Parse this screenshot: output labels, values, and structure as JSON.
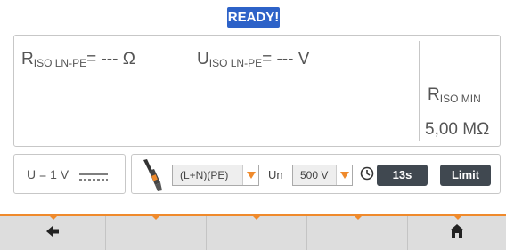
{
  "status": {
    "label": "READY!"
  },
  "results": {
    "riso": {
      "symbol": "R",
      "sub": "ISO LN-PE",
      "suffix": "= --- Ω"
    },
    "uiso": {
      "symbol": "U",
      "sub": "ISO LN-PE",
      "suffix": "= --- V"
    },
    "limit": {
      "symbol": "R",
      "sub": "ISO MIN",
      "value": "5,00 MΩ"
    }
  },
  "voltage_panel": {
    "text": "U = 1 V",
    "icon": "dc-icon"
  },
  "settings": {
    "probe_icon": "probe-icon",
    "terminal_select": {
      "value": "(L+N)(PE)"
    },
    "un_label": "Un",
    "voltage_select": {
      "value": "500 V"
    },
    "clock_icon": "clock-icon",
    "time_button": "13s",
    "limit_button": "Limit"
  },
  "toolbar": {
    "left_icon": "back-arrow-icon",
    "right_icon": "home-icon"
  },
  "colors": {
    "accent": "#ef8a2c",
    "status_bg": "#2d62c8",
    "button_dark": "#404850",
    "toolbar_bg": "#dddddd"
  }
}
